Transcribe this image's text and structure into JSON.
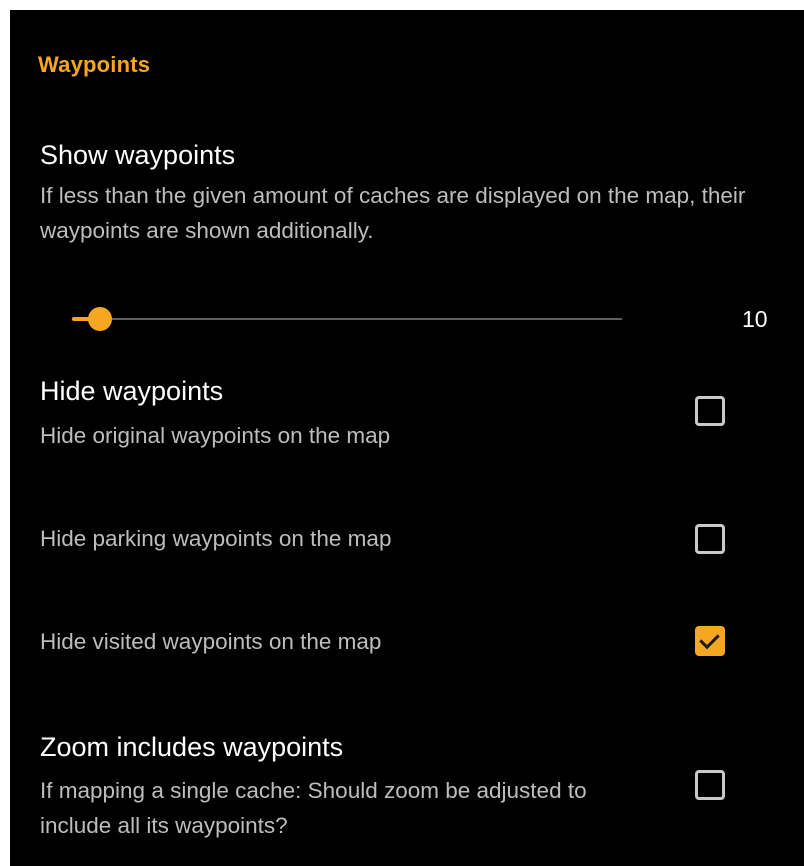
{
  "section": {
    "title": "Waypoints"
  },
  "show_waypoints": {
    "title": "Show waypoints",
    "summary": "If less than the given amount of caches are displayed on the map, their waypoints are shown additionally.",
    "slider_value": "10",
    "slider_fraction": 0.05
  },
  "hide_waypoints": {
    "title": "Hide waypoints",
    "summary": "Hide original waypoints on the map",
    "checked": false
  },
  "hide_parking": {
    "summary": "Hide parking waypoints on the map",
    "checked": false
  },
  "hide_visited": {
    "summary": "Hide visited waypoints on the map",
    "checked": true
  },
  "zoom_includes": {
    "title": "Zoom includes waypoints",
    "summary": "If mapping a single cache: Should zoom be adjusted to include all its waypoints?",
    "checked": false
  },
  "colors": {
    "accent": "#f5a623",
    "background": "#000000",
    "title_text": "#ffffff",
    "summary_text": "#bdbdbd"
  }
}
